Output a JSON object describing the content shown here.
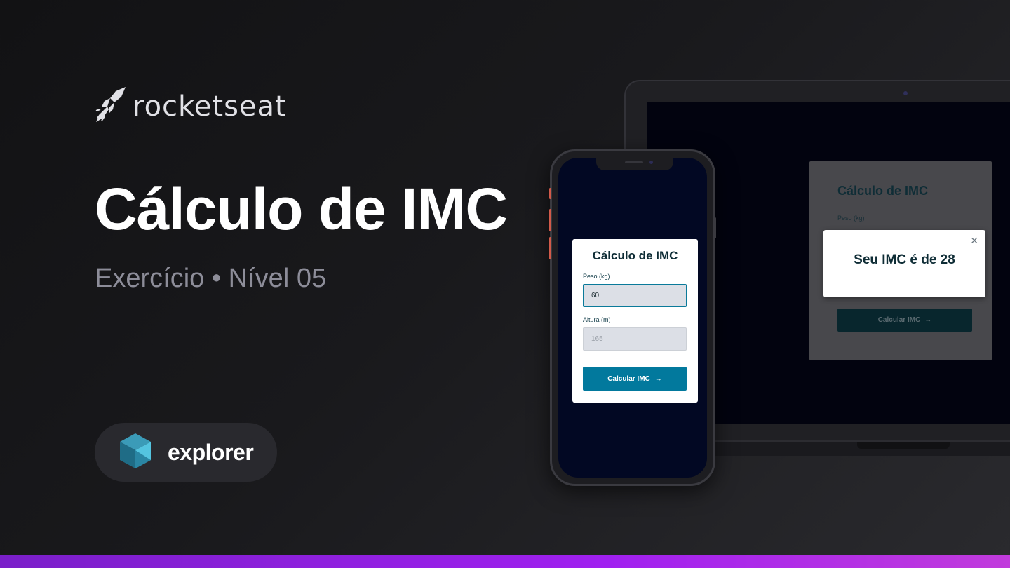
{
  "brand": {
    "name": "rocketseat",
    "logo_icon": "rocket-icon"
  },
  "hero": {
    "title": "Cálculo de IMC",
    "subtitle": "Exercício • Nível 05"
  },
  "badge": {
    "label": "explorer",
    "icon": "explorer-cube-icon"
  },
  "mobile_app": {
    "title": "Cálculo de IMC",
    "weight_label": "Peso (kg)",
    "weight_value": "60",
    "height_label": "Altura (m)",
    "height_placeholder": "165",
    "button_label": "Calcular IMC",
    "button_icon": "arrow-right-icon"
  },
  "desktop_app": {
    "title": "Cálculo de IMC",
    "weight_label": "Peso (kg)",
    "button_label": "Calcular IMC",
    "button_icon": "arrow-right-icon",
    "modal": {
      "result_text": "Seu IMC é de 28",
      "close_icon": "close-icon"
    }
  },
  "colors": {
    "accent": "#02799d",
    "card_heading": "#0f2d36",
    "bottom_bar": "#a020f0",
    "muted_text": "#8d8d99"
  }
}
